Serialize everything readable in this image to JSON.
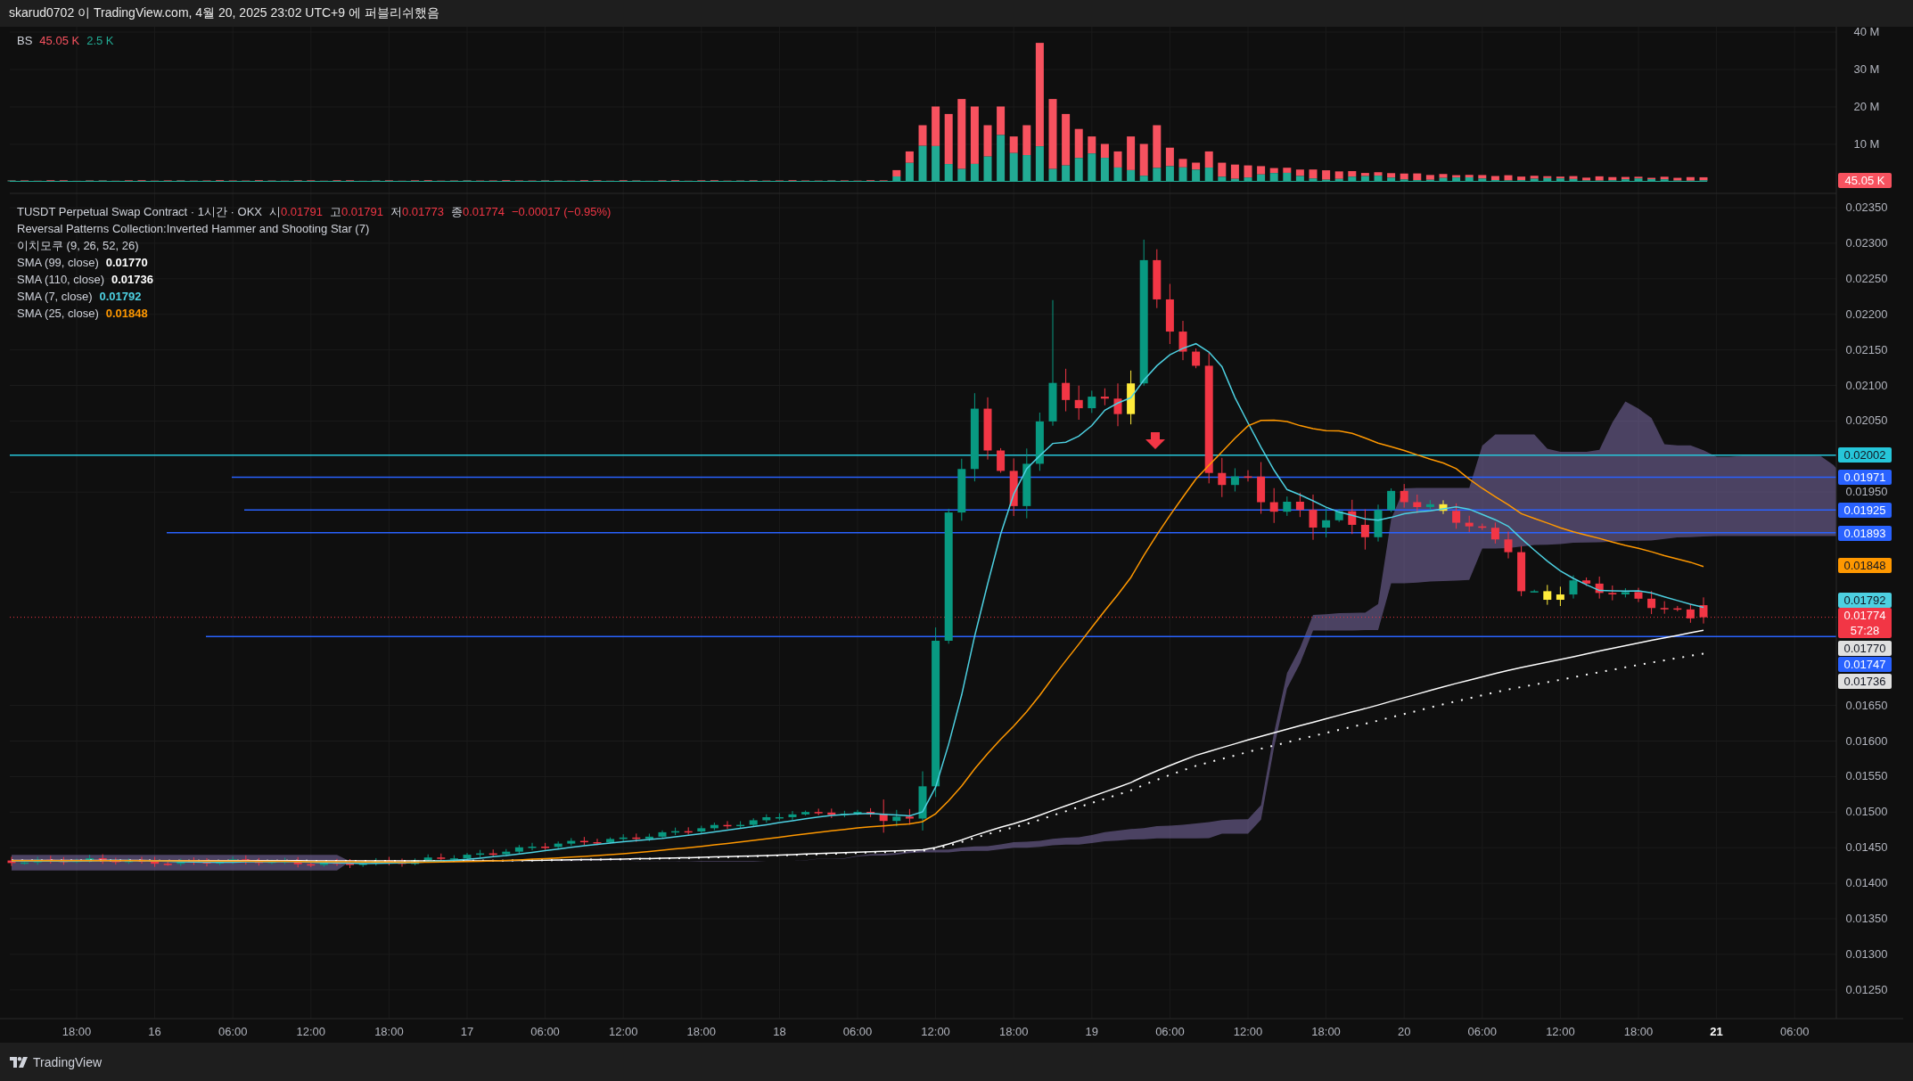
{
  "header": {
    "text": "skarud0702 이 TradingView.com, 4월 20, 2025 23:02 UTC+9 에 퍼블리쉬했음"
  },
  "volume_pane": {
    "name": "BS",
    "values": [
      {
        "text": "45.05 K",
        "color": "#f7525f"
      },
      {
        "text": "2.5 K",
        "color": "#22ab94"
      }
    ],
    "axis": [
      "40 M",
      "30 M",
      "20 M",
      "10 M"
    ],
    "tag": {
      "text": "45.05 K",
      "color": "#f7525f"
    }
  },
  "legend": {
    "symbol": "TUSDT Perpetual Swap Contract · 1시간 · OKX",
    "ohlc": [
      {
        "label": "시",
        "value": "0.01791",
        "color": "#f23645"
      },
      {
        "label": "고",
        "value": "0.01791",
        "color": "#f23645"
      },
      {
        "label": "저",
        "value": "0.01773",
        "color": "#f23645"
      },
      {
        "label": "종",
        "value": "0.01774",
        "color": "#f23645"
      }
    ],
    "change": {
      "text": "−0.00017 (−0.95%)",
      "color": "#f23645"
    }
  },
  "indicators": [
    {
      "name": "Reversal Patterns Collection:Inverted Hammer and Shooting Star (7)"
    },
    {
      "name": "이치모쿠 (9, 26, 52, 26)"
    },
    {
      "name": "SMA (99, close)",
      "value": "0.01770",
      "color": "#ffffff"
    },
    {
      "name": "SMA (110, close)",
      "value": "0.01736",
      "color": "#ffffff"
    },
    {
      "name": "SMA (7, close)",
      "value": "0.01792",
      "color": "#4dd0e1"
    },
    {
      "name": "SMA (25, close)",
      "value": "0.01848",
      "color": "#ff9800"
    }
  ],
  "price_axis": [
    "0.02350",
    "0.02300",
    "0.02250",
    "0.02200",
    "0.02150",
    "0.02100",
    "0.02050",
    "0.01950",
    "0.01650",
    "0.01600",
    "0.01550",
    "0.01500",
    "0.01450",
    "0.01400",
    "0.01350",
    "0.01300",
    "0.01250"
  ],
  "price_tags": [
    {
      "text": "0.02002",
      "color": "#26c6da"
    },
    {
      "text": "0.01971",
      "color": "#2962ff"
    },
    {
      "text": "0.01925",
      "color": "#2962ff"
    },
    {
      "text": "0.01893",
      "color": "#2962ff"
    },
    {
      "text": "0.01848",
      "color": "#ff9800"
    },
    {
      "text": "0.01792",
      "color": "#4dd0e1"
    },
    {
      "text": "0.01774",
      "countdown": "57:28",
      "color": "#f23645"
    },
    {
      "text": "0.01770",
      "color": "#e0e0e0"
    },
    {
      "text": "0.01747",
      "color": "#2962ff"
    },
    {
      "text": "0.01736",
      "color": "#e0e0e0"
    }
  ],
  "time_axis": [
    {
      "text": "18:00",
      "emphasized": false
    },
    {
      "text": "16",
      "emphasized": false
    },
    {
      "text": "06:00",
      "emphasized": false
    },
    {
      "text": "12:00",
      "emphasized": false
    },
    {
      "text": "18:00",
      "emphasized": false
    },
    {
      "text": "17",
      "emphasized": false
    },
    {
      "text": "06:00",
      "emphasized": false
    },
    {
      "text": "12:00",
      "emphasized": false
    },
    {
      "text": "18:00",
      "emphasized": false
    },
    {
      "text": "18",
      "emphasized": false
    },
    {
      "text": "06:00",
      "emphasized": false
    },
    {
      "text": "12:00",
      "emphasized": false
    },
    {
      "text": "18:00",
      "emphasized": false
    },
    {
      "text": "19",
      "emphasized": false
    },
    {
      "text": "06:00",
      "emphasized": false
    },
    {
      "text": "12:00",
      "emphasized": false
    },
    {
      "text": "18:00",
      "emphasized": false
    },
    {
      "text": "20",
      "emphasized": false
    },
    {
      "text": "06:00",
      "emphasized": false
    },
    {
      "text": "12:00",
      "emphasized": false
    },
    {
      "text": "18:00",
      "emphasized": false
    },
    {
      "text": "21",
      "emphasized": true
    },
    {
      "text": "06:00",
      "emphasized": false
    }
  ],
  "footer": {
    "brand": "TradingView"
  }
}
